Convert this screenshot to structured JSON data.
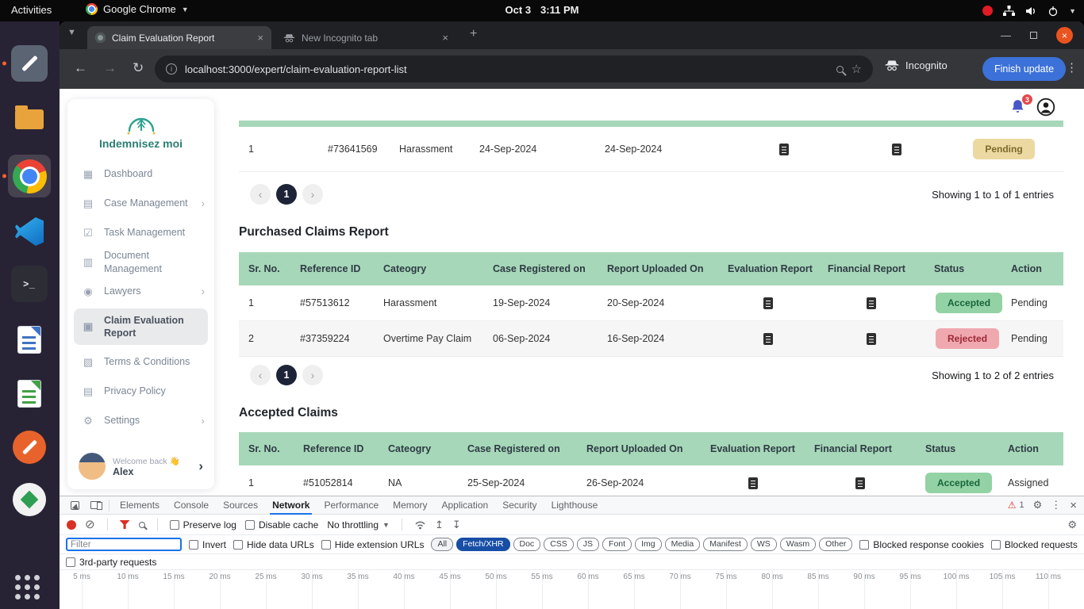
{
  "system_bar": {
    "activities_label": "Activities",
    "app_menu_label": "Google Chrome",
    "date": "Oct 3",
    "time": "3:11 PM"
  },
  "dock": {
    "icons": [
      "text-editor",
      "files",
      "chrome",
      "vscode",
      "terminal",
      "libreoffice-writer",
      "libreoffice-calc",
      "text-pencil",
      "diamond-app",
      "show-applications"
    ]
  },
  "browser": {
    "tabs": [
      {
        "title": "Claim Evaluation Report"
      },
      {
        "title": "New Incognito tab"
      }
    ],
    "url": "localhost:3000/expert/claim-evaluation-report-list",
    "incognito_label": "Incognito",
    "finish_update_label": "Finish update"
  },
  "page": {
    "brand": "Indemnisez moi",
    "sidebar": {
      "items": [
        {
          "label": "Dashboard"
        },
        {
          "label": "Case Management"
        },
        {
          "label": "Task Management"
        },
        {
          "label": "Document Management"
        },
        {
          "label": "Lawyers"
        },
        {
          "label": "Claim Evaluation Report"
        },
        {
          "label": "Terms & Conditions"
        },
        {
          "label": "Privacy Policy"
        },
        {
          "label": "Settings"
        }
      ],
      "user": {
        "greeting": "Welcome back 👋",
        "name": "Alex"
      }
    },
    "notifications_badge": "3",
    "top_table": {
      "row": {
        "sr": "1",
        "ref": "#73641569",
        "category": "Harassment",
        "registered": "24-Sep-2024",
        "uploaded": "24-Sep-2024",
        "status": "Pending"
      },
      "page": "1",
      "summary": "Showing 1 to 1 of 1 entries"
    },
    "purchased": {
      "title": "Purchased Claims Report",
      "headers": [
        "Sr. No.",
        "Reference ID",
        "Cateogry",
        "Case Registered on",
        "Report Uploaded On",
        "Evaluation Report",
        "Financial Report",
        "Status",
        "Action"
      ],
      "rows": [
        {
          "sr": "1",
          "ref": "#57513612",
          "category": "Harassment",
          "registered": "19-Sep-2024",
          "uploaded": "20-Sep-2024",
          "status": "Accepted",
          "action": "Pending"
        },
        {
          "sr": "2",
          "ref": "#37359224",
          "category": "Overtime Pay Claim",
          "registered": "06-Sep-2024",
          "uploaded": "16-Sep-2024",
          "status": "Rejected",
          "action": "Pending"
        }
      ],
      "page": "1",
      "summary": "Showing 1 to 2 of 2 entries"
    },
    "accepted": {
      "title": "Accepted Claims",
      "headers": [
        "Sr. No.",
        "Reference ID",
        "Cateogry",
        "Case Registered on",
        "Report Uploaded On",
        "Evaluation Report",
        "Financial Report",
        "Status",
        "Action"
      ],
      "rows": [
        {
          "sr": "1",
          "ref": "#51052814",
          "category": "NA",
          "registered": "25-Sep-2024",
          "uploaded": "26-Sep-2024",
          "status": "Accepted",
          "action": "Assigned"
        }
      ]
    }
  },
  "devtools": {
    "tabs": [
      "Elements",
      "Console",
      "Sources",
      "Network",
      "Performance",
      "Memory",
      "Application",
      "Security",
      "Lighthouse"
    ],
    "active_tab": "Network",
    "warning_count": "1",
    "toolbar": {
      "preserve_log": "Preserve log",
      "disable_cache": "Disable cache",
      "throttling": "No throttling"
    },
    "filter": {
      "placeholder": "Filter",
      "invert": "Invert",
      "hide_data_urls": "Hide data URLs",
      "hide_extension_urls": "Hide extension URLs",
      "chips": [
        "All",
        "Fetch/XHR",
        "Doc",
        "CSS",
        "JS",
        "Font",
        "Img",
        "Media",
        "Manifest",
        "WS",
        "Wasm",
        "Other"
      ],
      "active_chip": "Fetch/XHR",
      "blocked_cookies": "Blocked response cookies",
      "blocked_requests": "Blocked requests",
      "third_party": "3rd-party requests"
    },
    "timeline_labels": [
      "5 ms",
      "10 ms",
      "15 ms",
      "20 ms",
      "25 ms",
      "30 ms",
      "35 ms",
      "40 ms",
      "45 ms",
      "50 ms",
      "55 ms",
      "60 ms",
      "65 ms",
      "70 ms",
      "75 ms",
      "80 ms",
      "85 ms",
      "90 ms",
      "95 ms",
      "100 ms",
      "105 ms",
      "110 ms"
    ]
  }
}
